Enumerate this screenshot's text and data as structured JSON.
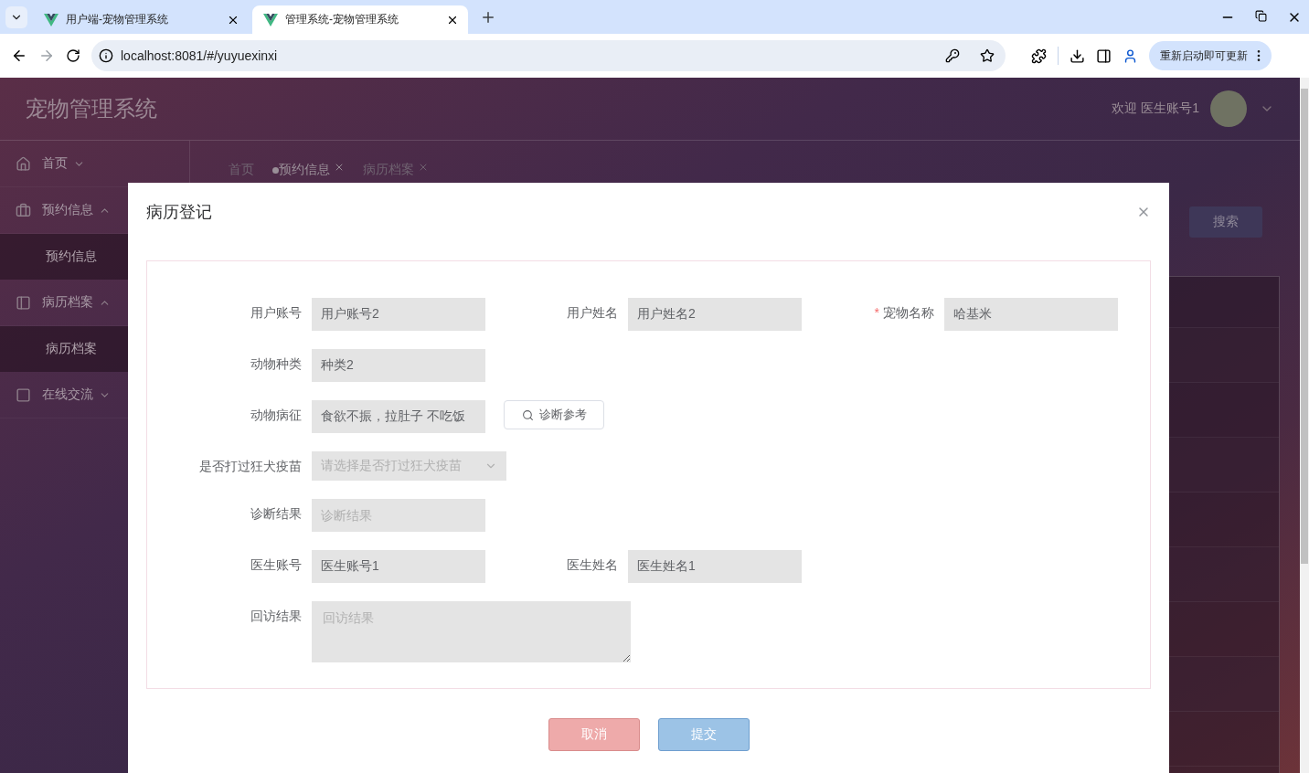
{
  "browser": {
    "tabs": [
      {
        "title": "用户端-宠物管理系统",
        "selected": false
      },
      {
        "title": "管理系统-宠物管理系统",
        "selected": true
      }
    ],
    "url": "localhost:8081/#/yuyuexinxi",
    "update_button": "重新启动即可更新"
  },
  "header": {
    "title": "宠物管理系统",
    "welcome": "欢迎 医生账号1"
  },
  "sidebar": {
    "items": [
      {
        "label": "首页",
        "expanded": false
      },
      {
        "label": "预约信息",
        "expanded": true,
        "children": [
          {
            "label": "预约信息"
          }
        ]
      },
      {
        "label": "病历档案",
        "expanded": true,
        "children": [
          {
            "label": "病历档案"
          }
        ]
      },
      {
        "label": "在线交流",
        "expanded": false
      }
    ]
  },
  "breadcrumb": [
    {
      "label": "首页",
      "selected": false,
      "closable": false
    },
    {
      "label": "预约信息",
      "selected": true,
      "closable": true
    },
    {
      "label": "病历档案",
      "selected": false,
      "closable": true
    }
  ],
  "search_button": "搜索",
  "dialog": {
    "title": "病历登记",
    "required_mark": "*",
    "rows": [
      [
        {
          "label": "用户账号",
          "kind": "input",
          "required": false,
          "value": "用户账号2"
        },
        {
          "label": "用户姓名",
          "kind": "input",
          "required": false,
          "value": "用户姓名2"
        },
        {
          "label": "宠物名称",
          "kind": "input",
          "required": true,
          "value": "哈基米"
        }
      ],
      [
        {
          "label": "动物种类",
          "kind": "input",
          "required": false,
          "value": "种类2"
        }
      ],
      [
        {
          "label": "动物病征",
          "kind": "input",
          "required": false,
          "value": "食欲不振，拉肚子 不吃饭",
          "action": "诊断参考"
        }
      ],
      [
        {
          "label": "是否打过狂犬疫苗",
          "kind": "select",
          "required": false,
          "placeholder": "请选择是否打过狂犬疫苗"
        }
      ],
      [
        {
          "label": "诊断结果",
          "kind": "input",
          "required": false,
          "placeholder": "诊断结果"
        }
      ],
      [
        {
          "label": "医生账号",
          "kind": "input",
          "required": false,
          "value": "医生账号1"
        },
        {
          "label": "医生姓名",
          "kind": "input",
          "required": false,
          "value": "医生姓名1"
        }
      ],
      [
        {
          "label": "回访结果",
          "kind": "textarea",
          "required": false,
          "placeholder": "回访结果"
        }
      ]
    ],
    "buttons": [
      {
        "label": "取消",
        "kind": "cancel"
      },
      {
        "label": "提交",
        "kind": "submit"
      }
    ]
  }
}
